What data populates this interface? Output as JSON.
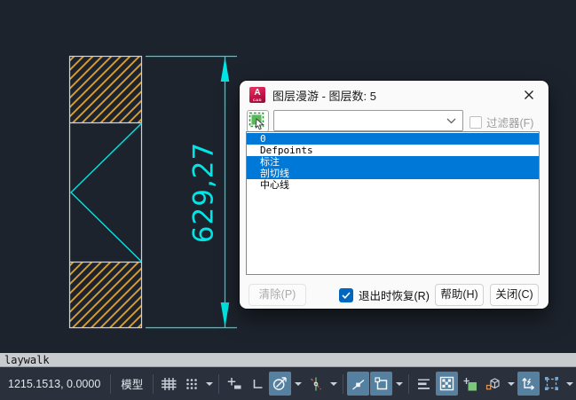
{
  "drawing": {
    "dimension_label": "629,27",
    "colors": {
      "canvas_bg": "#1d232d",
      "dimension_cyan": "#00e5e5",
      "hatch_orange": "#d79d33",
      "outline_gray": "#cfd3d8",
      "selection_blue": "#0078d7"
    }
  },
  "dialog": {
    "app_icon_letter": "A",
    "app_icon_sub": "CAD",
    "title": "图层漫游 - 图层数: 5",
    "combo_value": "",
    "filter_label": "过滤器(F)",
    "layers": [
      {
        "name": "0",
        "selected": true
      },
      {
        "name": "Defpoints",
        "selected": false
      },
      {
        "name": "标注",
        "selected": true
      },
      {
        "name": "剖切线",
        "selected": true
      },
      {
        "name": "中心线",
        "selected": false
      }
    ],
    "clear_label": "清除(P)",
    "restore_label": "退出时恢复(R)",
    "help_label": "帮助(H)",
    "close_label": "关闭(C)"
  },
  "command_bar": {
    "text": "laywalk"
  },
  "status_bar": {
    "coordinates": "1215.1513, 0.0000",
    "model_label": "模型"
  }
}
